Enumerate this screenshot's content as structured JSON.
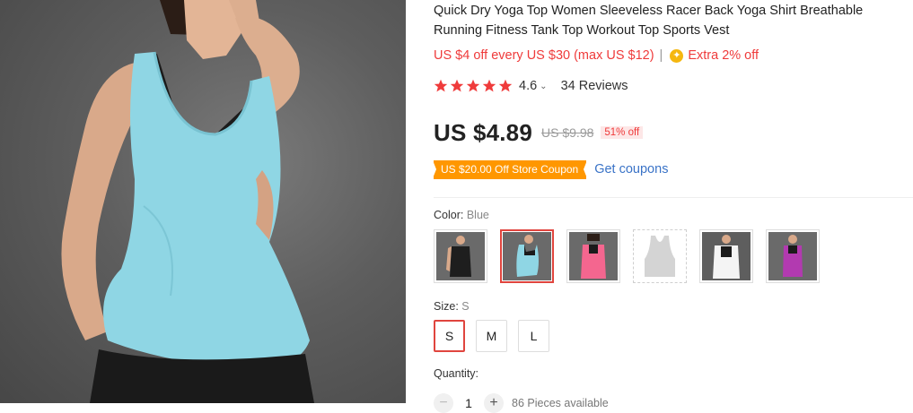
{
  "product": {
    "title": "Quick Dry Yoga Top Women Sleeveless Racer Back Yoga Shirt Breathable Running Fitness Tank Top Workout Top Sports Vest",
    "promo": {
      "store_discount": "US $4 off every US $30 (max US $12)",
      "separator": "|",
      "coin_icon": "coin-icon",
      "extra": "Extra 2% off"
    },
    "rating": {
      "stars": 5,
      "star_color": "#ef3b3b",
      "value": "4.6",
      "chevron": "⌄",
      "reviews": "34 Reviews"
    },
    "price": {
      "current": "US $4.89",
      "original": "US $9.98",
      "discount": "51% off"
    },
    "coupon": {
      "badge": "US $20.00 Off Store Coupon",
      "link": "Get coupons",
      "badge_color": "#ff9700"
    }
  },
  "options": {
    "color": {
      "label": "Color: ",
      "selected": "Blue",
      "swatches": [
        {
          "name": "Black",
          "color": "#1e1e1e",
          "selected": false
        },
        {
          "name": "Blue",
          "color": "#8fd6e4",
          "selected": true
        },
        {
          "name": "Pink",
          "color": "#f4668f",
          "selected": false
        },
        {
          "name": "Gray",
          "color": "#d4d4d4",
          "selected": false
        },
        {
          "name": "White",
          "color": "#f4f4f4",
          "selected": false
        },
        {
          "name": "Purple",
          "color": "#b23ab0",
          "selected": false
        }
      ]
    },
    "size": {
      "label": "Size: ",
      "selected": "S",
      "options": [
        "S",
        "M",
        "L"
      ]
    },
    "quantity": {
      "label": "Quantity:",
      "value": "1",
      "minus": "−",
      "plus": "+",
      "available": "86 Pieces available"
    }
  },
  "colors": {
    "accent": "#e0453e",
    "promo_red": "#ef3b3b",
    "link_blue": "#3a73c7"
  }
}
